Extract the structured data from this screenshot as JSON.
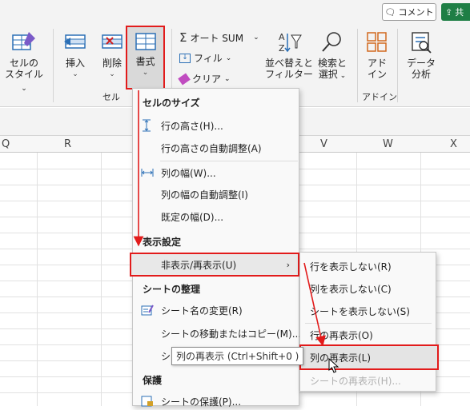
{
  "topbar": {
    "comment_label": "コメント",
    "share_label": "共"
  },
  "ribbon": {
    "cell_styles": {
      "line1": "セルの",
      "line2": "スタイル"
    },
    "insert_label": "挿入",
    "delete_label": "削除",
    "format_label": "書式",
    "cells_group": "セル",
    "autosum_label": "オート SUM",
    "fill_label": "フィル",
    "clear_label": "クリア",
    "sort_filter": {
      "line1": "並べ替えと",
      "line2": "フィルター"
    },
    "find_select": {
      "line1": "検索と",
      "line2": "選択"
    },
    "addin": {
      "line1": "アド",
      "line2": "イン"
    },
    "addin_group": "アドイン",
    "data_analysis": {
      "line1": "データ",
      "line2": "分析"
    }
  },
  "sheet": {
    "columns": [
      "Q",
      "R",
      "V",
      "W",
      "X"
    ]
  },
  "format_menu": {
    "cell_size_header": "セルのサイズ",
    "row_height": "行の高さ(H)...",
    "autofit_row": "行の高さの自動調整(A)",
    "col_width": "列の幅(W)...",
    "autofit_col": "列の幅の自動調整(I)",
    "default_width": "既定の幅(D)...",
    "visibility_header": "表示設定",
    "hide_unhide": "非表示/再表示(U)",
    "organize_header": "シートの整理",
    "rename_sheet": "シート名の変更(R)",
    "move_copy": "シートの移動またはコピー(M)...",
    "tab_color_partial": "シ",
    "protection_header": "保護",
    "protect_sheet": "シートの保護(P)..."
  },
  "submenu": {
    "hide_rows": "行を表示しない(R)",
    "hide_cols": "列を表示しない(C)",
    "hide_sheet": "シートを表示しない(S)",
    "unhide_rows": "行の再表示(O)",
    "unhide_cols": "列の再表示(L)",
    "unhide_sheet": "シートの再表示(H)..."
  },
  "tooltip": {
    "text": "列の再表示 (Ctrl+Shift+0 )"
  },
  "colors": {
    "accent_red": "#e21b1b",
    "excel_green": "#1e7e45",
    "icon_blue": "#2b6fb6"
  }
}
